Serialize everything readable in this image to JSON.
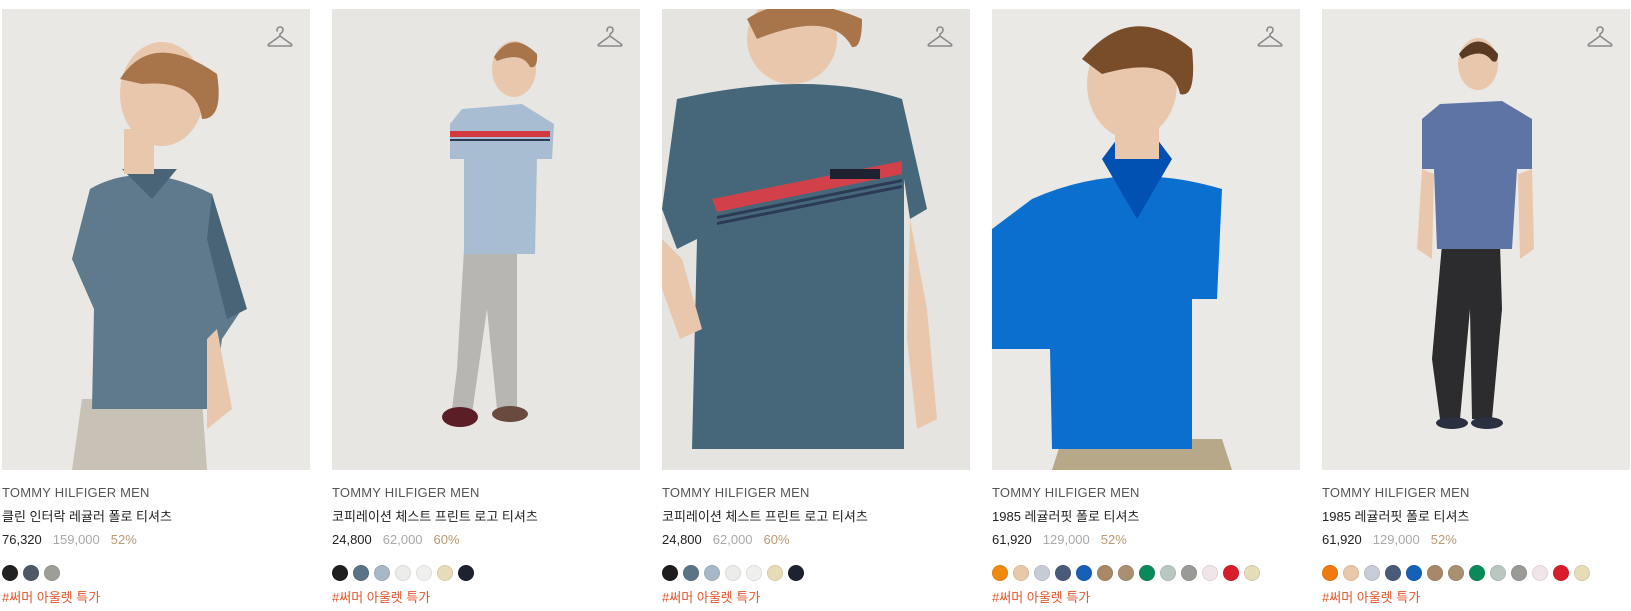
{
  "products": [
    {
      "brand": "TOMMY HILFIGER MEN",
      "name": "클린 인터락 레귤러 폴로 티셔츠",
      "price": "76,320",
      "original_price": "159,000",
      "discount": "52%",
      "swatches": [
        "#222222",
        "#4d5a66",
        "#9e9e98"
      ],
      "tag": "#써머 아울렛 특가",
      "shirt_color": "#5e7a8c",
      "bg_color": "#e9e8e4"
    },
    {
      "brand": "TOMMY HILFIGER MEN",
      "name": "코피레이션 체스트 프린트 로고 티셔츠",
      "price": "24,800",
      "original_price": "62,000",
      "discount": "60%",
      "swatches": [
        "#1e1e1e",
        "#5a7486",
        "#a8b8c8",
        "#ececea",
        "#f0f0ee",
        "#e8dcb8",
        "#1d2130"
      ],
      "tag": "#써머 아울렛 특가",
      "shirt_color": "#a9bdd2",
      "bg_color": "#e7e6e2"
    },
    {
      "brand": "TOMMY HILFIGER MEN",
      "name": "코피레이션 체스트 프린트 로고 티셔츠",
      "price": "24,800",
      "original_price": "62,000",
      "discount": "60%",
      "swatches": [
        "#1e1e1e",
        "#5a7486",
        "#a8b8c8",
        "#ececea",
        "#f0f0ee",
        "#e8dcb8",
        "#1d2130"
      ],
      "tag": "#써머 아울렛 특가",
      "shirt_color": "#46677a",
      "bg_color": "#e5e4e0"
    },
    {
      "brand": "TOMMY HILFIGER MEN",
      "name": "1985 레귤러핏 폴로 티셔츠",
      "price": "61,920",
      "original_price": "129,000",
      "discount": "52%",
      "swatches": [
        "#f08a10",
        "#e8c8a8",
        "#c8ccd6",
        "#4a5a7a",
        "#1760b8",
        "#a88868",
        "#a89070",
        "#0a8a5a",
        "#b8c8c0",
        "#9a9a96",
        "#f0e6ea",
        "#d81e2a",
        "#e6dcb8"
      ],
      "tag": "#써머 아울렛 특가",
      "shirt_color": "#0b6fd0",
      "bg_color": "#eae9e5"
    },
    {
      "brand": "TOMMY HILFIGER MEN",
      "name": "1985 레귤러핏 폴로 티셔츠",
      "price": "61,920",
      "original_price": "129,000",
      "discount": "52%",
      "swatches": [
        "#f07a10",
        "#e8c8a8",
        "#c8ccd6",
        "#4a5a7a",
        "#1760b8",
        "#a88868",
        "#a89070",
        "#0a8a5a",
        "#b8c8c0",
        "#9a9a96",
        "#f0e6ea",
        "#d81e2a",
        "#e6dcb8"
      ],
      "tag": "#써머 아울렛 특가",
      "shirt_color": "#5d74a4",
      "bg_color": "#eae9e5"
    }
  ]
}
